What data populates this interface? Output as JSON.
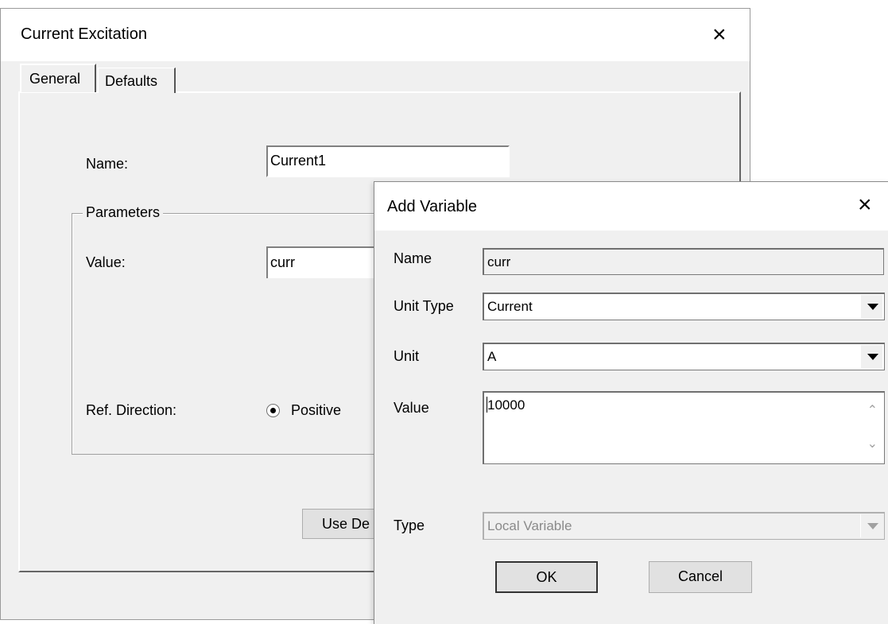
{
  "main_dialog": {
    "title": "Current Excitation",
    "close_glyph": "×",
    "tabs": [
      {
        "label": "General",
        "active": true
      },
      {
        "label": "Defaults",
        "active": false
      }
    ],
    "name_label": "Name:",
    "name_value": "Current1",
    "parameters_group_label": "Parameters",
    "value_label": "Value:",
    "value_value": "curr",
    "ref_direction_label": "Ref. Direction:",
    "positive_label": "Positive",
    "use_defaults_button_label": "Use De"
  },
  "add_variable_dialog": {
    "title": "Add Variable",
    "close_glyph": "×",
    "name_label": "Name",
    "name_value": "curr",
    "unit_type_label": "Unit Type",
    "unit_type_value": "Current",
    "unit_label": "Unit",
    "unit_value": "A",
    "value_label": "Value",
    "value_value": "10000",
    "scroll_up_glyph": "⌃",
    "scroll_down_glyph": "⌄",
    "type_label": "Type",
    "type_value": "Local Variable",
    "ok_label": "OK",
    "cancel_label": "Cancel"
  }
}
